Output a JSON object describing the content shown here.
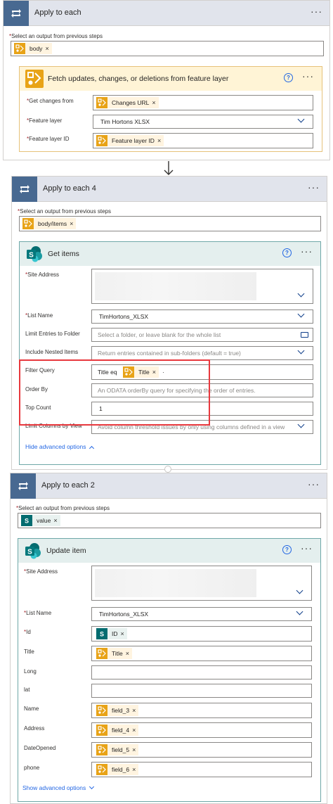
{
  "loop1": {
    "title": "Apply to each",
    "select_label": "Select an output from previous steps",
    "token": "body",
    "fetch": {
      "title": "Fetch updates, changes, or deletions from feature layer",
      "fields": [
        {
          "label": "Get changes from",
          "token": "Changes URL"
        },
        {
          "label": "Feature layer",
          "value": "Tim Hortons XLSX"
        },
        {
          "label": "Feature layer ID",
          "token": "Feature layer ID"
        }
      ]
    }
  },
  "loop2": {
    "title": "Apply to each 4",
    "select_label": "Select an output from previous steps",
    "token": "body/items",
    "get_items": {
      "title": "Get items",
      "fields": [
        {
          "label": "Site Address",
          "required": true
        },
        {
          "label": "List Name",
          "required": true,
          "value": "TimHortons_XLSX"
        },
        {
          "label": "Limit Entries to Folder",
          "placeholder": "Select a folder, or leave blank for the whole list"
        },
        {
          "label": "Include Nested Items",
          "placeholder": "Return entries contained in sub-folders (default = true)"
        },
        {
          "label": "Filter Query",
          "prefix": "Title eq",
          "token": "Title",
          "suffix": "·"
        },
        {
          "label": "Order By",
          "placeholder": "An ODATA orderBy query for specifying the order of entries."
        },
        {
          "label": "Top Count",
          "value": "1"
        },
        {
          "label": "Limit Columns by View",
          "placeholder": "Avoid column threshold issues by only using columns defined in a view"
        }
      ],
      "hide_advanced": "Hide advanced options"
    }
  },
  "loop3": {
    "title": "Apply to each 2",
    "select_label": "Select an output from previous steps",
    "token": "value",
    "update_item": {
      "title": "Update item",
      "fields": [
        {
          "label": "Site Address",
          "required": true
        },
        {
          "label": "List Name",
          "required": true,
          "value": "TimHortons_XLSX"
        },
        {
          "label": "Id",
          "required": true,
          "token": "ID"
        },
        {
          "label": "Title",
          "token": "Title"
        },
        {
          "label": "Long"
        },
        {
          "label": "lat"
        },
        {
          "label": "Name",
          "token": "field_3"
        },
        {
          "label": "Address",
          "token": "field_4"
        },
        {
          "label": "DateOpened",
          "token": "field_5"
        },
        {
          "label": "phone",
          "token": "field_6"
        }
      ],
      "show_advanced": "Show advanced options"
    }
  },
  "common": {
    "required_mark": "*",
    "remove_mark": "×",
    "more_mark": "···",
    "help_mark": "?"
  },
  "colors": {
    "loop_icon": "#486991",
    "arcgis_token": "#e8a317",
    "sharepoint": "#036c70",
    "link": "#2266e3",
    "highlight": "#e8383d"
  },
  "icons": {
    "loop": "loop-arrows-icon",
    "arcgis": "arcgis-icon",
    "sharepoint": "sharepoint-icon",
    "help": "help-circle-icon",
    "chevron": "chevron-down-icon",
    "folder": "folder-icon",
    "arrow": "arrow-down-icon"
  }
}
